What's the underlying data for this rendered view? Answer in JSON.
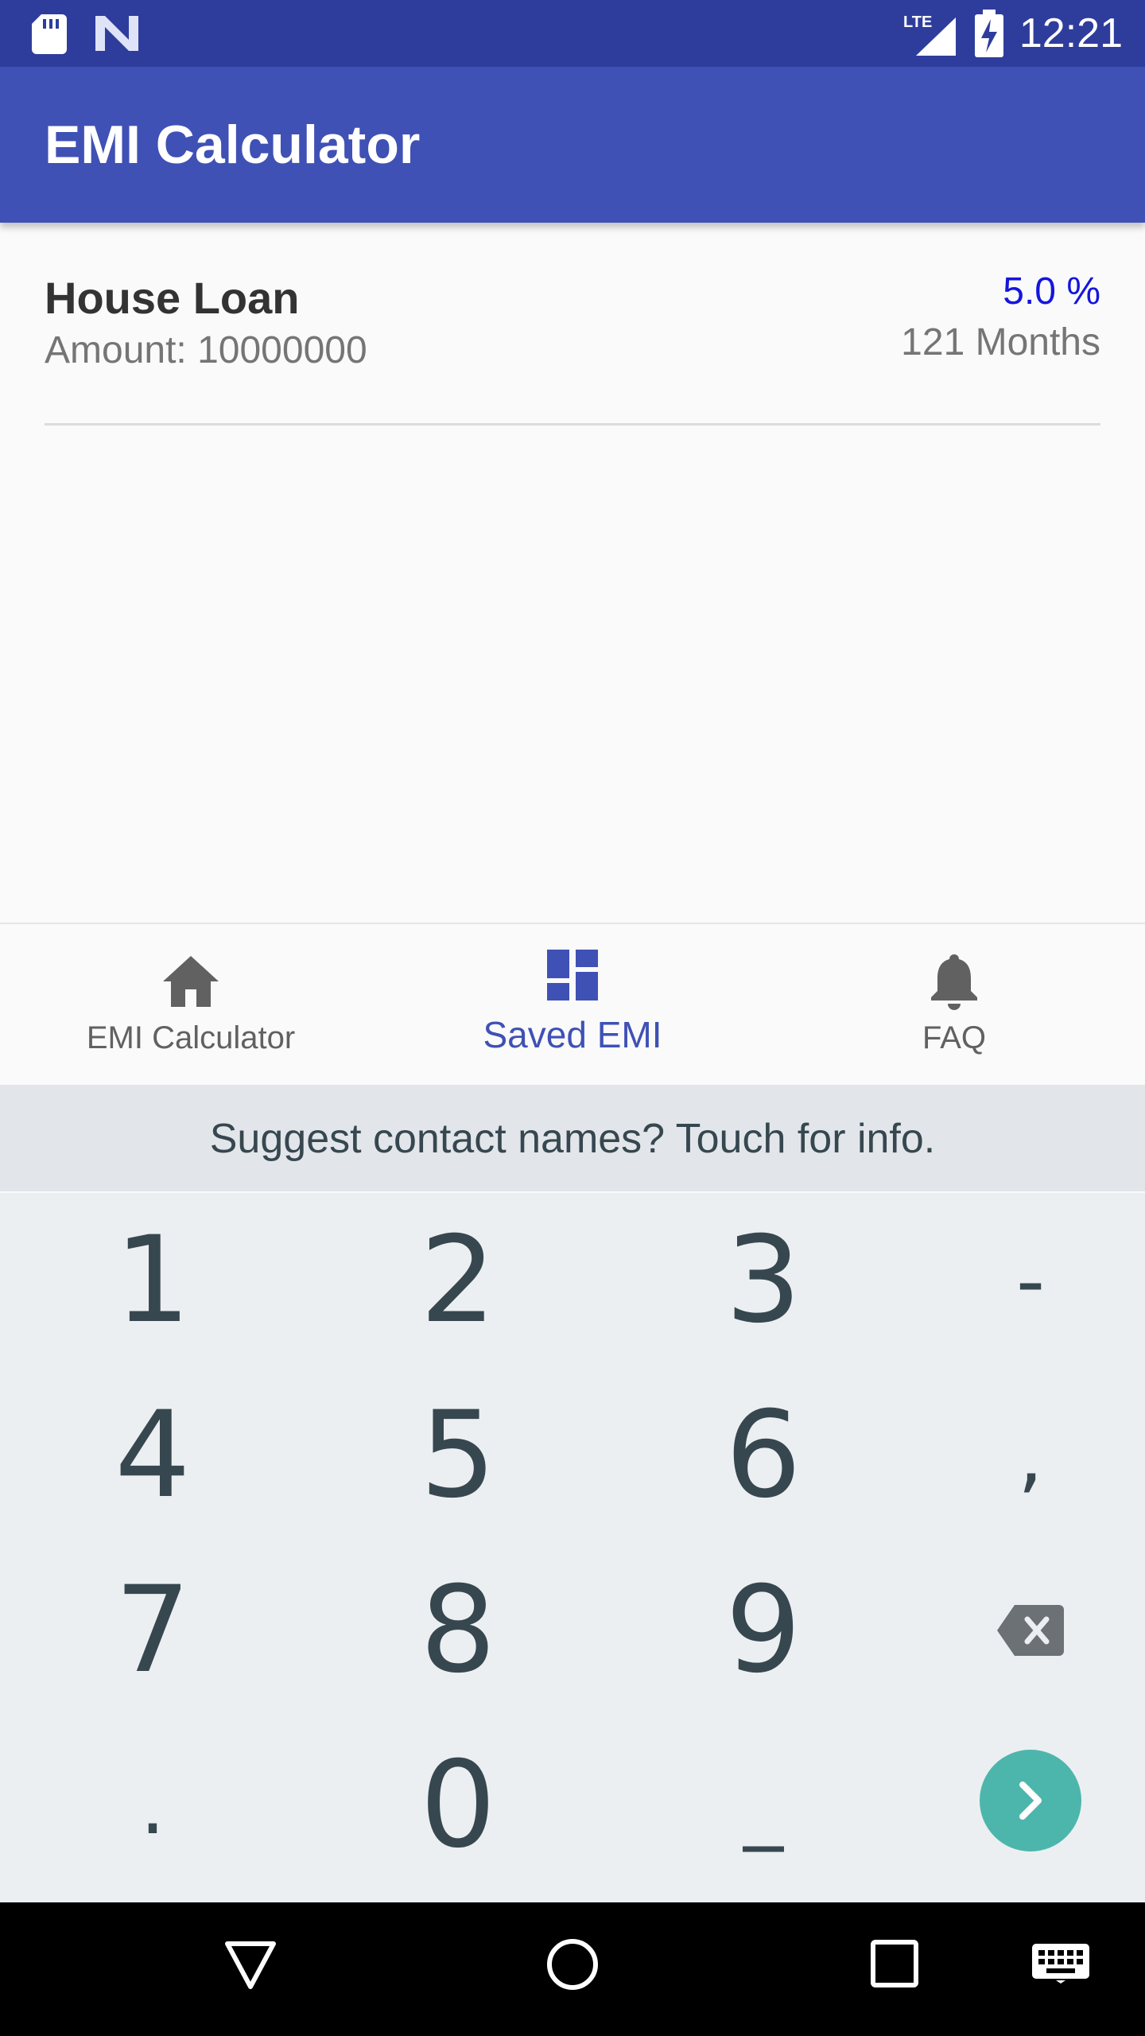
{
  "status_bar": {
    "time": "12:21",
    "network": "LTE"
  },
  "app_bar": {
    "title": "EMI Calculator"
  },
  "saved_items": [
    {
      "name": "House Loan",
      "amount_label": "Amount: 10000000",
      "rate": "5.0 %",
      "months": "121 Months"
    }
  ],
  "bottom_nav": {
    "items": [
      {
        "label": "EMI Calculator",
        "icon": "home-icon",
        "active": false
      },
      {
        "label": "Saved EMI",
        "icon": "dashboard-icon",
        "active": true
      },
      {
        "label": "FAQ",
        "icon": "bell-icon",
        "active": false
      }
    ],
    "active_color": "#3f51b5"
  },
  "keyboard": {
    "suggestion": "Suggest contact names? Touch for info.",
    "keys": {
      "row1": [
        "1",
        "2",
        "3",
        "-"
      ],
      "row2": [
        "4",
        "5",
        "6",
        ","
      ],
      "row3": [
        "7",
        "8",
        "9"
      ],
      "row4": [
        ".",
        "0",
        "_"
      ]
    },
    "enter_color": "#4db6ac"
  },
  "colors": {
    "status_bar": "#2e3d9c",
    "app_bar": "#3f51b5",
    "rate": "#1515dd"
  }
}
